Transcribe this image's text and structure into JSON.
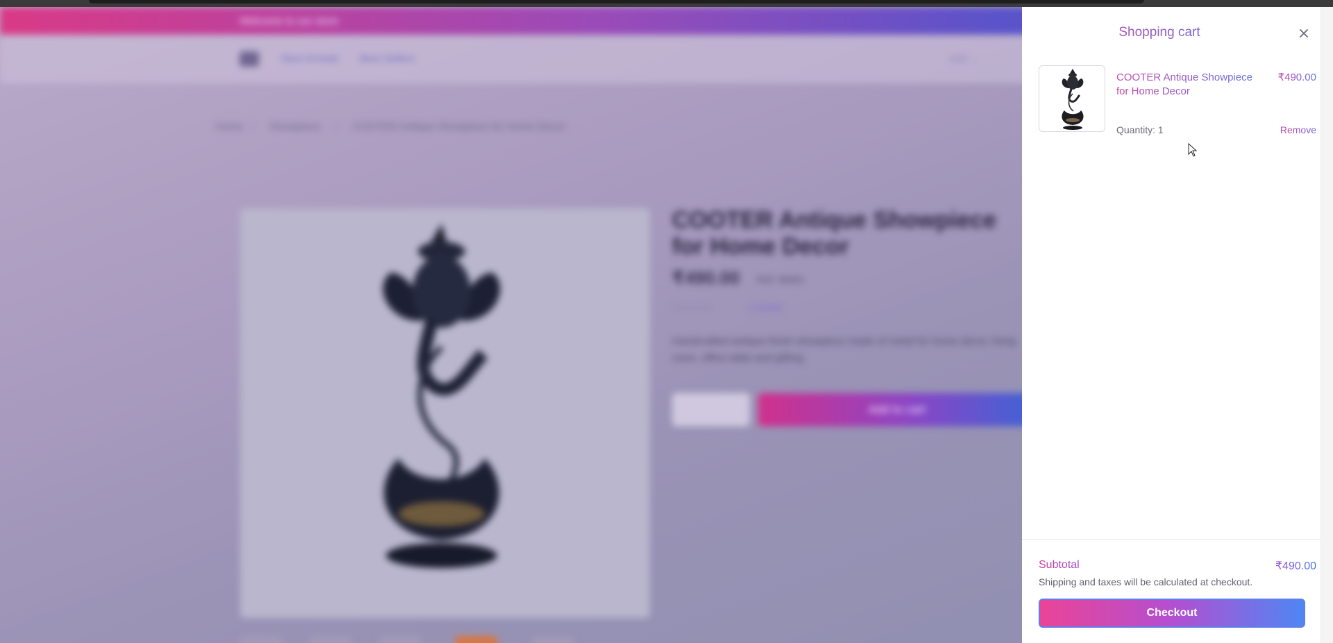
{
  "background": {
    "promo_text": "Welcome to our store",
    "nav_links": [
      "New Arrivals",
      "Best Sellers"
    ],
    "currency": "INR ⌄",
    "breadcrumb": [
      "Home",
      "Showpiece",
      "COOTER Antique Showpiece for Home Decor"
    ],
    "product_title": "COOTER Antique Showpiece for Home Decor",
    "product_price": "₹490.00",
    "product_tax": "Incl. taxes",
    "product_rating": "★★★★★",
    "product_reviews": "1 review",
    "product_description": "Handcrafted antique finish showpiece made of metal for home decor, living room, office table and gifting.",
    "add_to_cart": "Add to cart"
  },
  "cart": {
    "title": "Shopping cart",
    "close_icon": "close-icon",
    "items": [
      {
        "name": "COOTER Antique Showpiece for Home Decor",
        "price": "₹490.00",
        "quantity": "Quantity: 1",
        "remove_label": "Remove",
        "thumbnail_icon": "ganesha-figurine-image"
      }
    ],
    "subtotal_label": "Subtotal",
    "subtotal_value": "₹490.00",
    "shipping_note": "Shipping and taxes will be calculated at checkout.",
    "checkout_label": "Checkout"
  },
  "colors": {
    "accent_pink": "#e94496",
    "accent_blue": "#4f86f4",
    "accent_purple": "#9a4bb8"
  }
}
